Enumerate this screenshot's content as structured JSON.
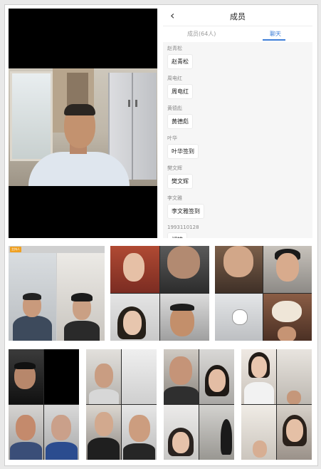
{
  "header": {
    "title": "成员",
    "back_icon": "chevron-left-icon"
  },
  "tabs": [
    {
      "label": "成员(64人)"
    },
    {
      "label": "聊天"
    }
  ],
  "chat": [
    {
      "name": "赵青松",
      "message": "赵青松"
    },
    {
      "name": "周电红",
      "message": "周电红"
    },
    {
      "name": "黄德彪",
      "message": "黄德彪"
    },
    {
      "name": "叶华",
      "message": "叶华签到"
    },
    {
      "name": "樊文辉",
      "message": "樊文辉"
    },
    {
      "name": "李文雅",
      "message": "李文雅签到"
    },
    {
      "name": "1993110128",
      "message": "郑雄"
    }
  ],
  "grid1_tags": {
    "presenter": "主持人"
  },
  "colors": {
    "accent": "#3f7fd8",
    "video_bg": "#000000"
  }
}
